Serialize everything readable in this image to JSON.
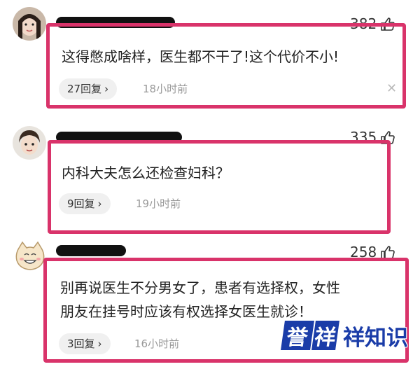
{
  "colors": {
    "highlight_border": "#d9336a",
    "watermark_blue": "#1a3ca8"
  },
  "comments": [
    {
      "likes": "382",
      "text_lines": [
        "这得憋成啥样，医生都不干了!这个代价不小!"
      ],
      "replies": "27回复",
      "time": "18小时前"
    },
    {
      "likes": "335",
      "text_lines": [
        "内科大夫怎么还检查妇科？"
      ],
      "replies": "9回复",
      "time": "19小时前"
    },
    {
      "likes": "258",
      "text_lines": [
        "别再说医生不分男女了，患者有选择权，女性",
        "朋友在挂号时应该有权选择女医生就诊！"
      ],
      "replies": "3回复",
      "time": "16小时前"
    }
  ],
  "watermark": {
    "tile1": "誉",
    "tile2": "祥",
    "text": "祥知识"
  }
}
